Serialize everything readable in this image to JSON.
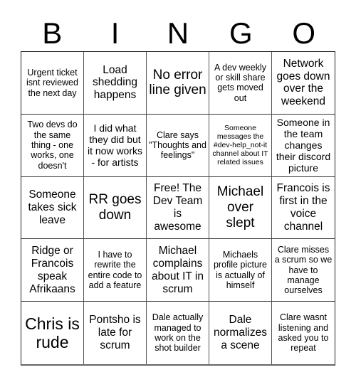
{
  "header": {
    "letters": [
      "B",
      "I",
      "N",
      "G",
      "O"
    ]
  },
  "cells": [
    {
      "text": "Urgent ticket isnt reviewed the next day",
      "size": "sm"
    },
    {
      "text": "Load shedding happens",
      "size": "lg"
    },
    {
      "text": "No error line given",
      "size": "xl"
    },
    {
      "text": "A dev weekly or skill share gets moved out",
      "size": "sm"
    },
    {
      "text": "Network goes down over the weekend",
      "size": "lg"
    },
    {
      "text": "Two devs do the same thing - one works, one doesn't",
      "size": "sm"
    },
    {
      "text": "I did what they did but it now works - for artists",
      "size": "md"
    },
    {
      "text": "Clare says \"Thoughts and feelings\"",
      "size": "sm"
    },
    {
      "text": "Someone messages the #dev-help_not-it channel about IT related issues",
      "size": "xs"
    },
    {
      "text": "Someone in the team changes their discord picture",
      "size": "md"
    },
    {
      "text": "Someone takes sick leave",
      "size": "lg"
    },
    {
      "text": "RR goes down",
      "size": "xl"
    },
    {
      "text": "Free! The Dev Team is awesome",
      "size": "lg"
    },
    {
      "text": "Michael over slept",
      "size": "xl"
    },
    {
      "text": "Francois is first in the voice channel",
      "size": "lg"
    },
    {
      "text": "Ridge or Francois speak Afrikaans",
      "size": "lg"
    },
    {
      "text": "I have to rewrite the entire code to add a feature",
      "size": "sm"
    },
    {
      "text": "Michael complains about IT in scrum",
      "size": "lg"
    },
    {
      "text": "Michaels profile picture is actually of himself",
      "size": "sm"
    },
    {
      "text": "Clare misses a scrum so we have to manage ourselves",
      "size": "sm"
    },
    {
      "text": "Chris is rude",
      "size": "xxl"
    },
    {
      "text": "Pontsho is late for scrum",
      "size": "lg"
    },
    {
      "text": "Dale actually managed to work on the shot builder",
      "size": "sm"
    },
    {
      "text": "Dale normalizes a scene",
      "size": "lg"
    },
    {
      "text": "Clare wasnt listening and asked you to repeat",
      "size": "sm"
    }
  ]
}
